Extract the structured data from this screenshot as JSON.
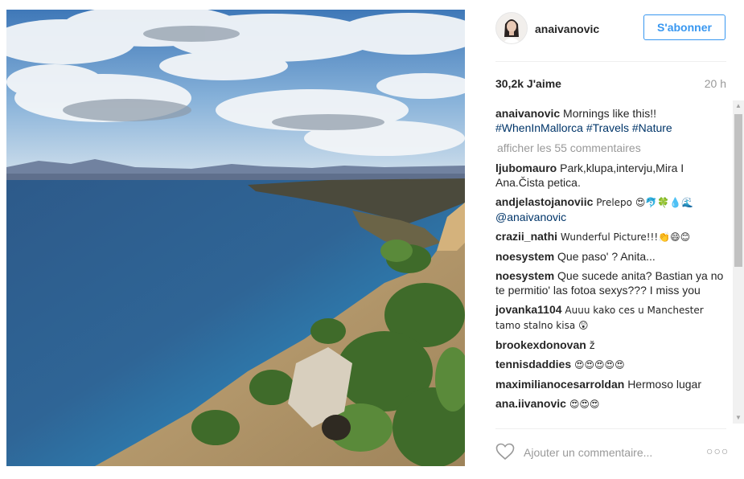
{
  "post": {
    "username": "anaivanovic",
    "follow_label": "S'abonner",
    "likes": "30,2k J'aime",
    "time": "20 h",
    "caption_user": "anaivanovic",
    "caption_text": "Mornings like this!!",
    "hashtags": [
      "#WhenInMallorca",
      "#Travels",
      "#Nature"
    ],
    "view_all": "afficher les 55 commentaires",
    "comment_placeholder": "Ajouter un commentaire...",
    "more_icon": "more-dots-icon"
  },
  "comments": [
    {
      "user": "ljubomauro",
      "text": "Park,klupa,intervju,Mira I Ana.Čista petica."
    },
    {
      "user": "andjelastojanoviic",
      "text": "Prelepo 😍🐬🍀💧🌊",
      "mention": "@anaivanovic"
    },
    {
      "user": "crazii_nathi",
      "text": "Wunderful Picture!!!👏😄😊"
    },
    {
      "user": "noesystem",
      "text": "Que paso' ? Anita..."
    },
    {
      "user": "noesystem",
      "text": "Que sucede anita? Bastian ya no te permitio' las fotoa sexys??? I miss you"
    },
    {
      "user": "jovanka1104",
      "text": "Auuu kako ces u Manchester tamo stalno kisa 😲"
    },
    {
      "user": "brookexdonovan",
      "text": "ž"
    },
    {
      "user": "tennisdaddies",
      "text": "😍😍😍😍😍"
    },
    {
      "user": "maximilianocesarroldan",
      "text": "Hermoso lugar"
    },
    {
      "user": "ana.iivanovic",
      "text": "😍😍😍"
    }
  ]
}
